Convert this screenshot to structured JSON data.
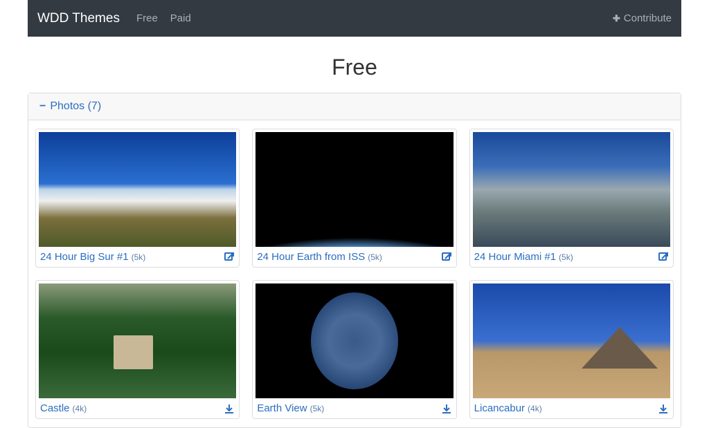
{
  "navbar": {
    "brand": "WDD Themes",
    "link_free": "Free",
    "link_paid": "Paid",
    "contribute": "Contribute"
  },
  "page_title": "Free",
  "panel": {
    "header": "Photos (7)"
  },
  "cards": [
    {
      "title": "24 Hour Big Sur #1",
      "res": "(5k)",
      "action": "external"
    },
    {
      "title": "24 Hour Earth from ISS",
      "res": "(5k)",
      "action": "external"
    },
    {
      "title": "24 Hour Miami #1",
      "res": "(5k)",
      "action": "external"
    },
    {
      "title": "Castle",
      "res": "(4k)",
      "action": "download"
    },
    {
      "title": "Earth View",
      "res": "(5k)",
      "action": "download"
    },
    {
      "title": "Licancabur",
      "res": "(4k)",
      "action": "download"
    }
  ]
}
